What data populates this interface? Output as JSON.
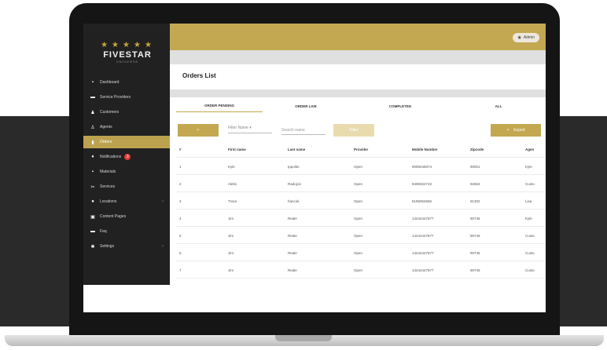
{
  "brand": {
    "stars": "★★★★★",
    "name": "FIVESTAR",
    "sub": "UNIVERSE"
  },
  "topbar": {
    "admin_label": "Admin"
  },
  "sidebar": {
    "items": [
      {
        "label": "Dashboard",
        "icon": "grid-icon",
        "glyph": "▪"
      },
      {
        "label": "Service Providers",
        "icon": "car-icon",
        "glyph": "▬"
      },
      {
        "label": "Customers",
        "icon": "people-icon",
        "glyph": "♟"
      },
      {
        "label": "Agents",
        "icon": "person-icon",
        "glyph": "♙"
      },
      {
        "label": "Orders",
        "icon": "document-icon",
        "glyph": "▮"
      },
      {
        "label": "Notifications",
        "icon": "bell-icon",
        "glyph": "♦",
        "badge": "3"
      },
      {
        "label": "Materials",
        "icon": "grid-icon",
        "glyph": "▪"
      },
      {
        "label": "Services",
        "icon": "tools-icon",
        "glyph": "✂"
      },
      {
        "label": "Locations",
        "icon": "map-pin-icon",
        "glyph": "●"
      },
      {
        "label": "Content Pages",
        "icon": "pages-icon",
        "glyph": "▣"
      },
      {
        "label": "Faq",
        "icon": "chat-icon",
        "glyph": "▬"
      },
      {
        "label": "Settings",
        "icon": "gear-icon",
        "glyph": "✱"
      }
    ]
  },
  "main": {
    "title": "Orders List",
    "tabs": [
      "ORDER PENDING",
      "ORDER LIVE",
      "COMPLETED",
      "ALL"
    ],
    "add_button": "+",
    "filter_label": "Filter Name ▾",
    "search_placeholder": "Search name",
    "filter_button": "Filter",
    "export_button": "Export",
    "export_icon": "×",
    "columns": [
      "#",
      "First name",
      "Last name",
      "Provider",
      "Mobile Number",
      "Zipcode",
      "Agen"
    ],
    "rows": [
      [
        "1",
        "Kyle",
        "Ippolito",
        "Open",
        "9095046974",
        "90001",
        "Kyle"
      ],
      [
        "2",
        "Aleks",
        "Radojcic",
        "Open",
        "9499322743",
        "92663",
        "Custo"
      ],
      [
        "3",
        "Trace",
        "hancok",
        "Open",
        "8185054656",
        "91302",
        "Lisa"
      ],
      [
        "4",
        "Jim",
        "Reale",
        "Open",
        "14244447877",
        "90745",
        "Kyle"
      ],
      [
        "5",
        "Jim",
        "Reale",
        "Open",
        "14244447877",
        "90745",
        "Custo"
      ],
      [
        "6",
        "Jim",
        "Reale",
        "Open",
        "14244447877",
        "90745",
        "Custo"
      ],
      [
        "7",
        "Jim",
        "Reale",
        "Open",
        "14244447877",
        "90745",
        "Custo"
      ]
    ]
  },
  "colors": {
    "gold": "#c3a851",
    "sidebar": "#212121",
    "bezel": "#151515"
  }
}
